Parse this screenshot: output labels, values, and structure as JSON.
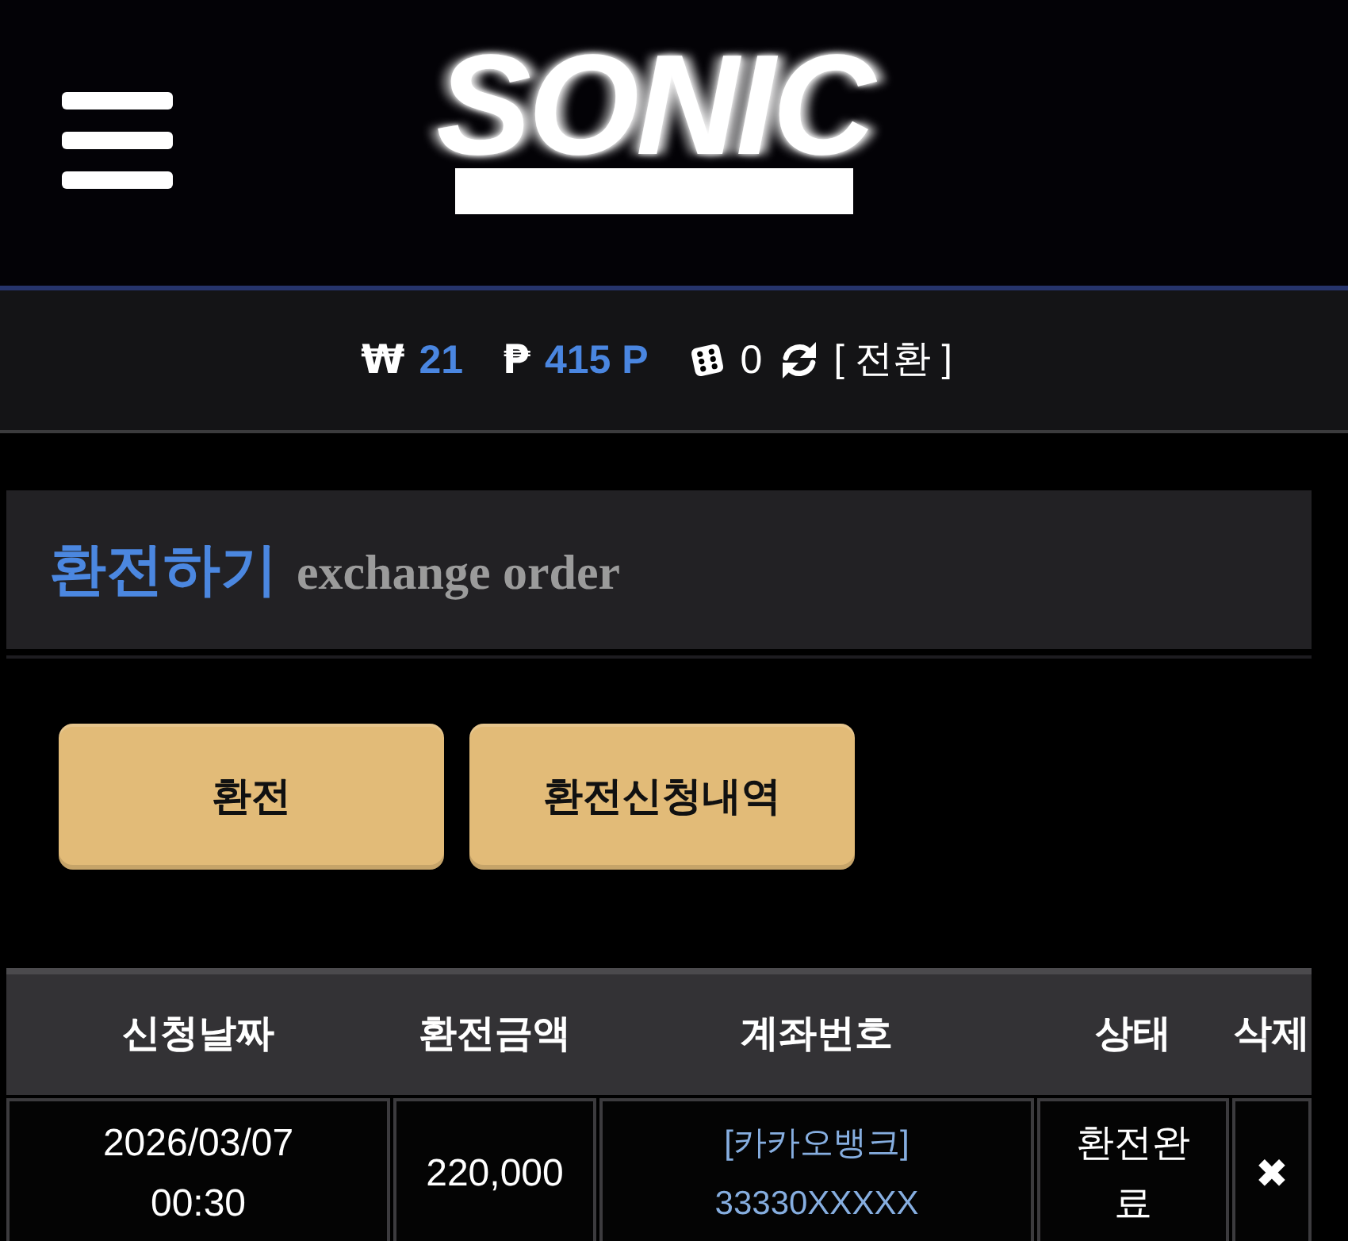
{
  "header": {
    "logo": "SONIC"
  },
  "wallet_bar": {
    "items": [
      {
        "kind": "currency",
        "symbol": "₩",
        "amount": "21"
      },
      {
        "kind": "currency",
        "symbol": "₱",
        "amount": "415 P"
      },
      {
        "kind": "dice",
        "count": "0"
      },
      {
        "kind": "switch",
        "label": "[ 전환 ]"
      }
    ]
  },
  "title_panel": {
    "title": "환전하기",
    "subtitle": "exchange order"
  },
  "buttons": [
    "환전",
    "환전신청내역"
  ],
  "table": {
    "columns": [
      "신청날짜",
      "환전금액",
      "계좌번호",
      "상태",
      "삭제"
    ],
    "rows": [
      {
        "date": "2026/03/07 00:30",
        "amount": "220,000",
        "bank": "[카카오뱅크]",
        "account_number": "33330XXXXX",
        "status": "환전완료",
        "delete": "✖"
      }
    ]
  }
}
